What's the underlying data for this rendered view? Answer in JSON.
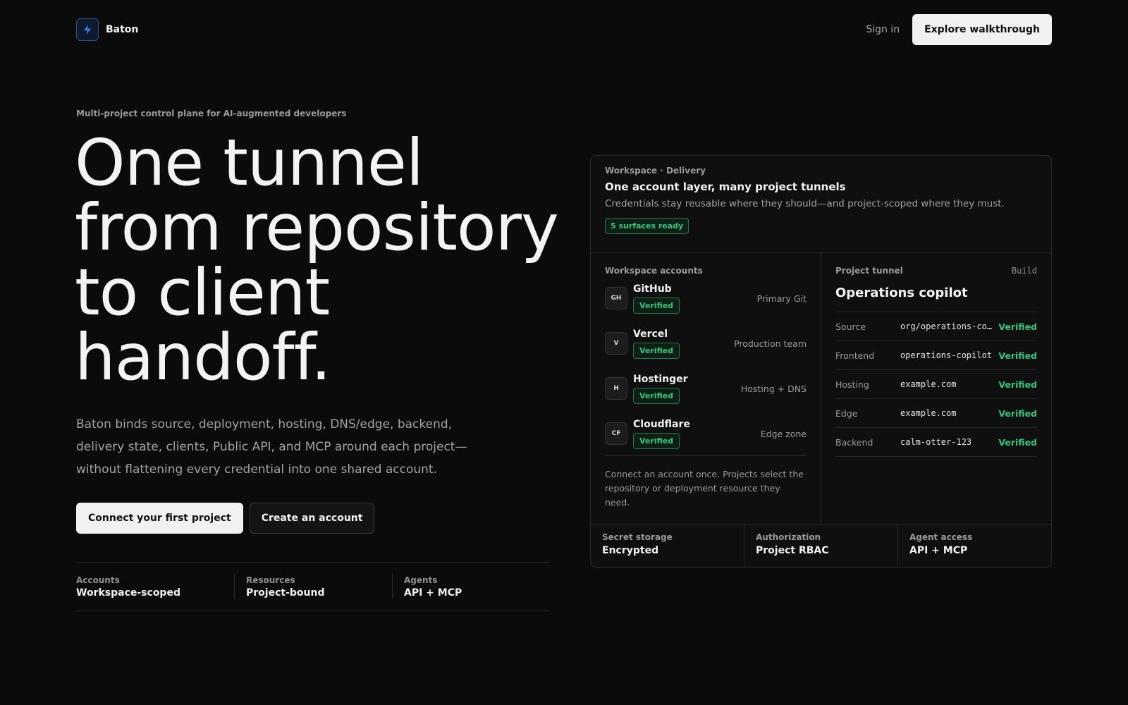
{
  "header": {
    "brand": "Baton",
    "logo_icon": "lightning-bolt-icon",
    "accent_color": "#3b82f6",
    "signin_label": "Sign in",
    "cta_label": "Explore walkthrough"
  },
  "hero": {
    "eyebrow": "Multi-project control plane for AI-augmented developers",
    "title": "One tunnel from repository to client handoff.",
    "description": "Baton binds source, deployment, hosting, DNS/edge, backend, delivery state, clients, Public API, and MCP around each project—without flattening every credential into one shared account.",
    "primary_cta": "Connect your first project",
    "secondary_cta": "Create an account",
    "stats": [
      {
        "label": "Accounts",
        "value": "Workspace-scoped"
      },
      {
        "label": "Resources",
        "value": "Project-bound"
      },
      {
        "label": "Agents",
        "value": "API + MCP"
      }
    ]
  },
  "card": {
    "eyebrow": "Workspace · Delivery",
    "title": "One account layer, many project tunnels",
    "subtitle": "Credentials stay reusable where they should—and project-scoped where they must.",
    "badge": "5 surfaces ready",
    "accounts_label": "Workspace accounts",
    "accounts": [
      {
        "initials": "GH",
        "name": "GitHub",
        "status": "Verified",
        "role": "Primary Git"
      },
      {
        "initials": "V",
        "name": "Vercel",
        "status": "Verified",
        "role": "Production team"
      },
      {
        "initials": "H",
        "name": "Hostinger",
        "status": "Verified",
        "role": "Hosting + DNS"
      },
      {
        "initials": "CF",
        "name": "Cloudflare",
        "status": "Verified",
        "role": "Edge zone"
      }
    ],
    "accounts_note": "Connect an account once. Projects select the repository or deployment resource they need.",
    "tunnel_label": "Project tunnel",
    "tunnel_stage": "Build",
    "tunnel_title": "Operations copilot",
    "tunnel_rows": [
      {
        "key": "Source",
        "value": "org/operations-co…",
        "status": "Verified"
      },
      {
        "key": "Frontend",
        "value": "operations-copilot",
        "status": "Verified"
      },
      {
        "key": "Hosting",
        "value": "example.com",
        "status": "Verified"
      },
      {
        "key": "Edge",
        "value": "example.com",
        "status": "Verified"
      },
      {
        "key": "Backend",
        "value": "calm-otter-123",
        "status": "Verified"
      }
    ],
    "footer": [
      {
        "label": "Secret storage",
        "value": "Encrypted"
      },
      {
        "label": "Authorization",
        "value": "Project RBAC"
      },
      {
        "label": "Agent access",
        "value": "API + MCP"
      }
    ],
    "status_color": "#34c77b"
  }
}
